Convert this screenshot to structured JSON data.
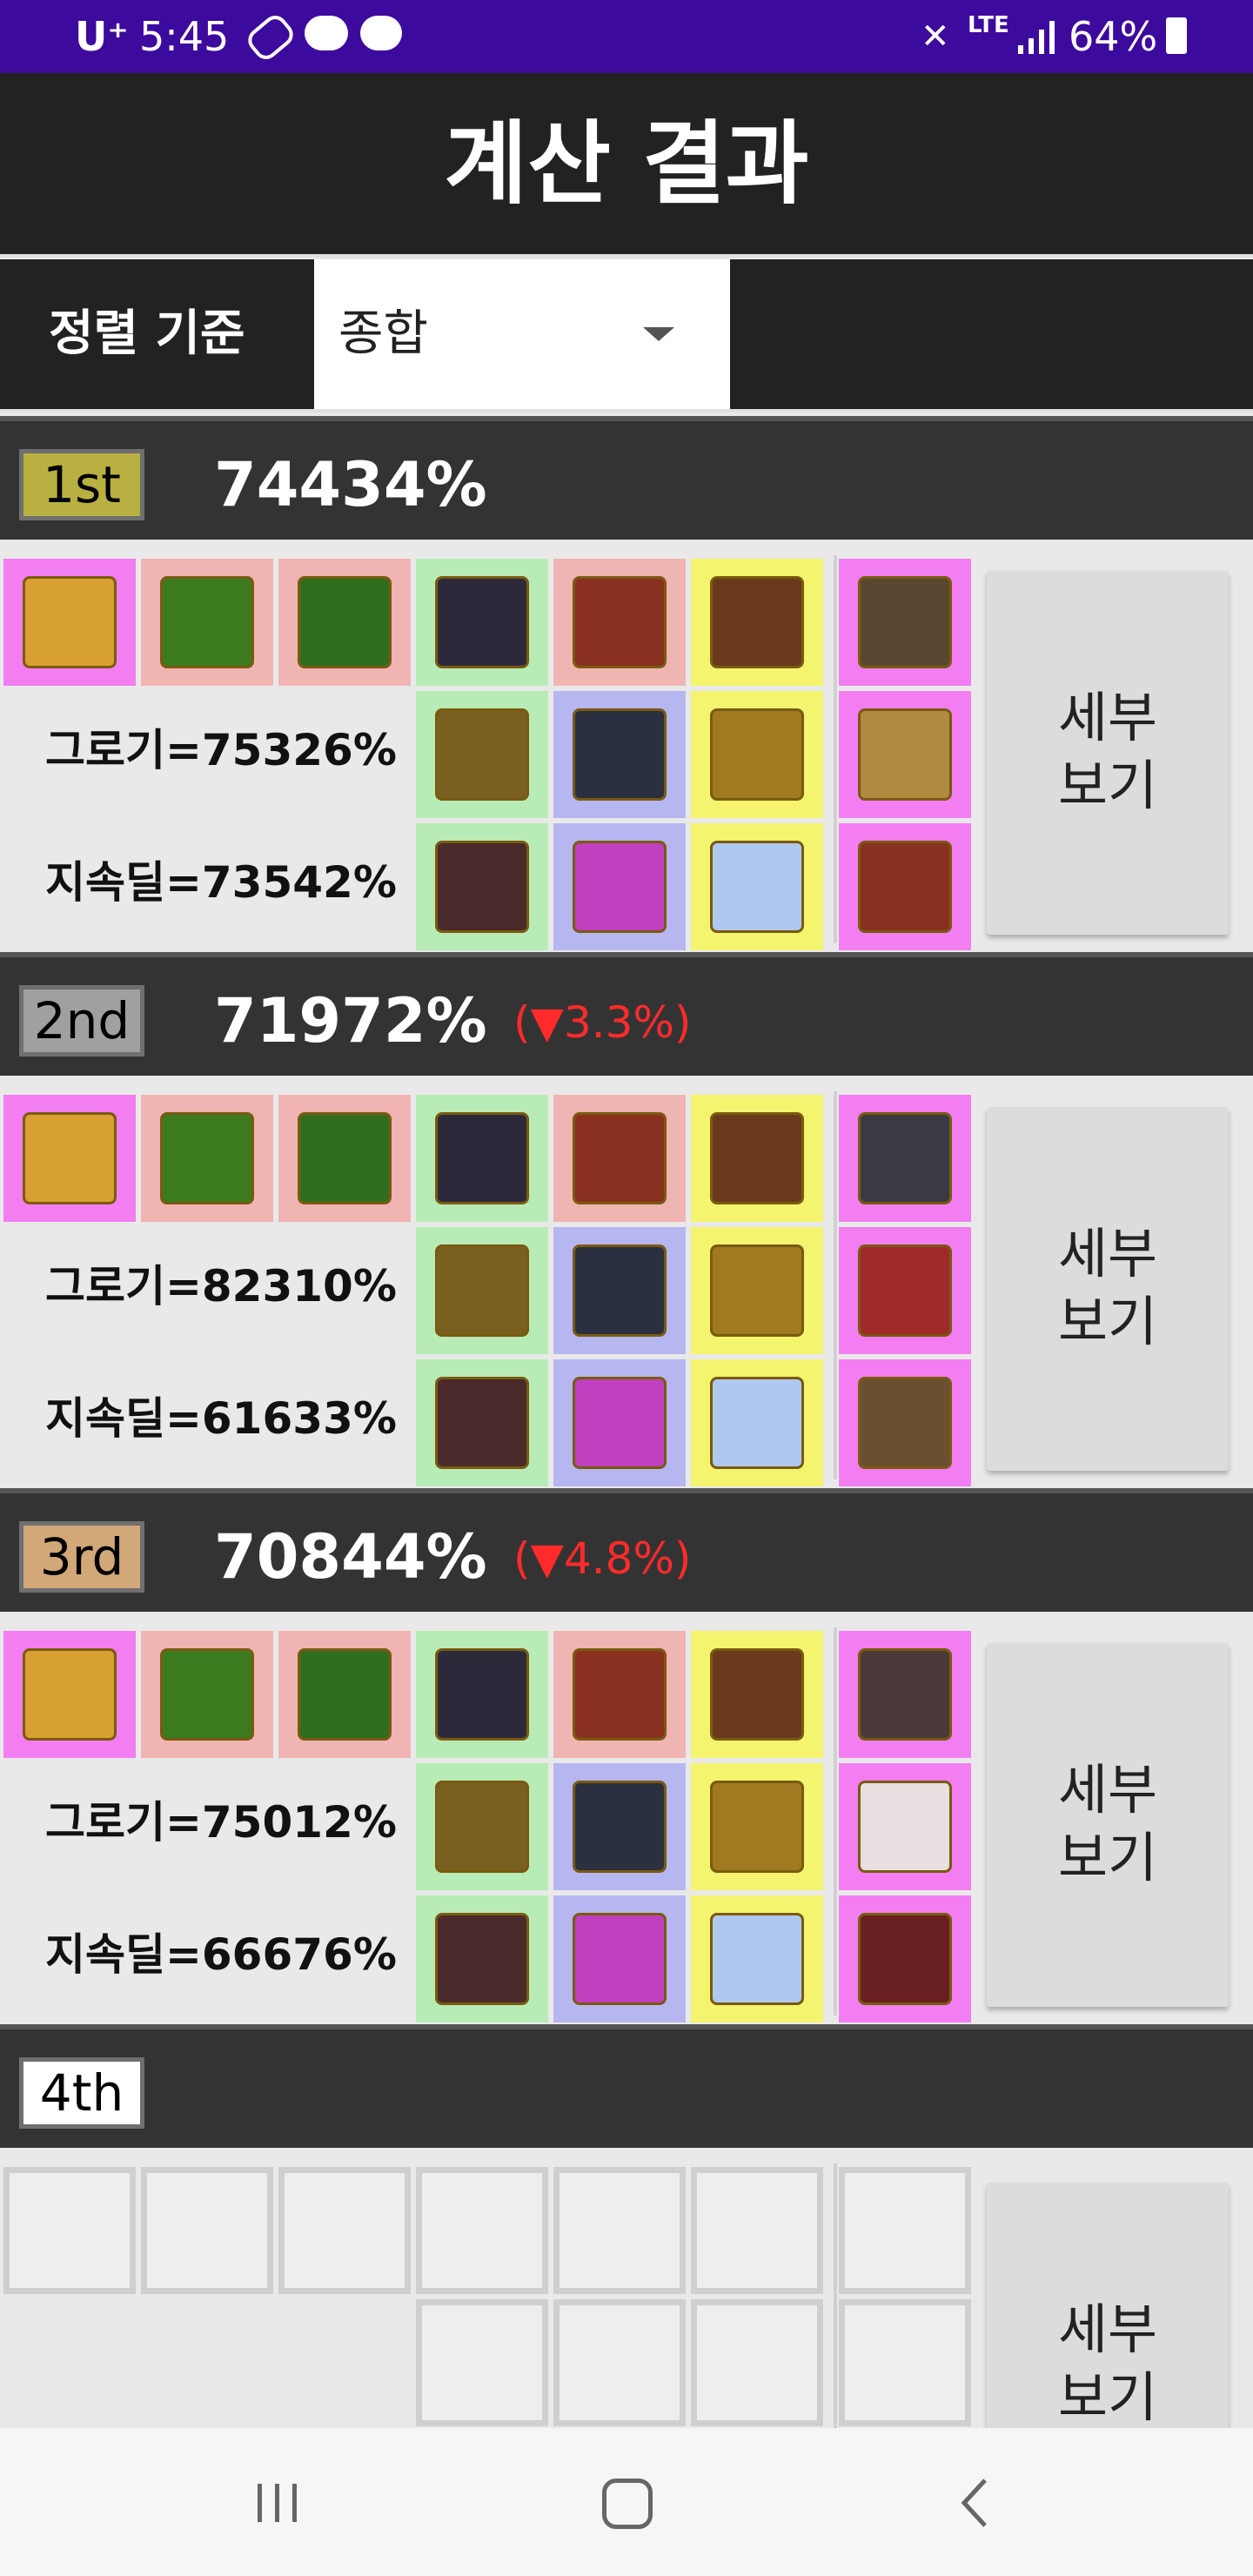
{
  "status_bar": {
    "carrier": "U⁺",
    "time": "5:45",
    "network": "LTE",
    "battery": "64%"
  },
  "header": {
    "title": "계산 결과"
  },
  "sort": {
    "label": "정렬 기준",
    "selected": "종합"
  },
  "detail_button": {
    "line1": "세부",
    "line2": "보기"
  },
  "results": [
    {
      "rank": "1st",
      "score": "74434%",
      "delta": "",
      "badge_color": "#b8b040",
      "groggy": "그로기=75326%",
      "sustain": "지속딜=73542%",
      "icons": {
        "row1": [
          "weapon-icon",
          "top-armor-icon",
          "shoulder-icon",
          "bracelet-icon",
          "necklace-icon",
          "boots-icon",
          "special-pants-icon"
        ],
        "row2": [
          "blade-icon",
          "gem-icon",
          "ring-icon",
          "special-ring-icon"
        ],
        "row3": [
          "chest-icon",
          "potion-icon",
          "orb-icon",
          "special-belt-icon"
        ]
      }
    },
    {
      "rank": "2nd",
      "score": "71972%",
      "delta": "(▼3.3%)",
      "badge_color": "#a0a0a0",
      "groggy": "그로기=82310%",
      "sustain": "지속딜=61633%",
      "icons": {
        "row1": [
          "weapon-icon",
          "top-armor-icon",
          "shoulder-icon",
          "bracelet-icon",
          "necklace-icon",
          "boots-icon",
          "special-pants-icon"
        ],
        "row2": [
          "blade-icon",
          "gem-icon",
          "ring-icon",
          "special-hood-icon"
        ],
        "row3": [
          "chest-icon",
          "potion-icon",
          "orb-icon",
          "special-gauntlet-icon"
        ]
      }
    },
    {
      "rank": "3rd",
      "score": "70844%",
      "delta": "(▼4.8%)",
      "badge_color": "#d2a878",
      "groggy": "그로기=75012%",
      "sustain": "지속딜=66676%",
      "icons": {
        "row1": [
          "weapon-icon",
          "top-armor-icon",
          "shoulder-icon",
          "bracelet-icon",
          "necklace-icon",
          "boots-icon",
          "special-pants-icon"
        ],
        "row2": [
          "blade-icon",
          "gem-icon",
          "ring-icon",
          "special-dice-icon"
        ],
        "row3": [
          "chest-icon",
          "potion-icon",
          "orb-icon",
          "special-emblem-icon"
        ]
      }
    },
    {
      "rank": "4th",
      "score": "",
      "delta": "",
      "badge_color": "#ffffff",
      "groggy": "",
      "sustain": "",
      "icons": {}
    }
  ]
}
